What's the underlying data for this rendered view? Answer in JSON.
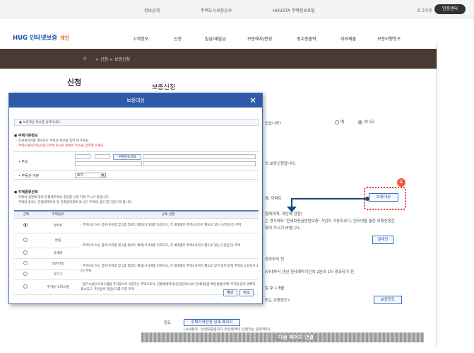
{
  "topbar": {
    "links": [
      "정보공개",
      "주택도시보증공사",
      "HOUSTA 주택정보포털"
    ],
    "login": "로그아웃",
    "cert_button": "인증센터"
  },
  "header": {
    "logo": "HUG 인터넷보증",
    "logo_suffix": "개인",
    "menu": [
      "고객정보",
      "신청",
      "발급/재발급",
      "보증해지/변경",
      "영수증출력",
      "자료제출",
      "보증이행청구"
    ]
  },
  "breadcrumb": {
    "home_icon": "home-icon",
    "items": [
      "신청",
      "보증신청"
    ]
  },
  "page": {
    "side_title": "신청",
    "main_title": "보증신청"
  },
  "background": {
    "question_fragment": "있습니까?",
    "radio_yes": "예",
    "radio_no": "아니오",
    "applied_fragment": "의 보증신청합니다.",
    "fragment_a": "형, 아파트",
    "button_target": "보증대상",
    "fragment_b": "형제자매, 개인에 한함)",
    "fragment_c": "는 경우에도 '전세보증금반환보증' 가입이 가능하오나, 인터넷을 통한 보증신청은",
    "fragment_d": "하여 주시기 바랍니다.",
    "button_lease": "임대인",
    "fragment_e": "경과하지 전",
    "fragment_f": "(이내부터 갱신 전세계약기간의 2분의 1이 경과하기 전",
    "fragment_g": "일 후 1개월",
    "fragment_h": "또는 보증한도?",
    "button_limit": "보증한도",
    "limit_label": "한도",
    "limit_button": "주택가격산정 상세 페이지",
    "limit_note": "(시세정보: 전세보증금보다 주산정액이 인정되는 일부제외)",
    "next_page": "다음 페이지 연결"
  },
  "annotation": {
    "badge": "1"
  },
  "modal": {
    "title": "보증대상",
    "info": "보증대상 정보를 입력하세요.",
    "house_section": "주택기본정보",
    "house_note1": "· 전세계약서를 계약하신 주택의 정보를 입력 해 주세요.",
    "house_note2": "· 주택소재지/부동산등기부에 표시된 정확한 주소를 입력해 주세요.",
    "address_label": "주소",
    "postal_button": "우편번호검색",
    "property_label": "부동산 구분",
    "property_value": "토지",
    "type_section": "주택종류선택",
    "type_note1": "· 아래의 설명에 따라 전월세주택의 종류를 선택 하여 주시기 바랍니다.",
    "type_note2": "· 주택의 종류는 전월세계약서 및 건축물대장에 표시된 '주택의 용도'를 기준으로 합니다.",
    "table_headers": [
      "선택",
      "주택종류",
      "상세 설명"
    ],
    "rows": [
      {
        "type": "아파트",
        "desc": "· 주택으로 쓰는 층수(지하층 및 1층 필로티 제외)가 5개층 이상이고, 각 세대별로 주택소유자가 별도로 있는 (구분등기) 주택",
        "selected": true
      },
      {
        "type": "연립",
        "desc": "· 주택으로 쓰는 층수(지하층 및 1층 필로티 제외)가 4개층 이하이고, 각 세대별로 주택소유자가 별도로 있는(구분등기) 주택",
        "selected": false
      },
      {
        "type": "다세대",
        "desc": "",
        "selected": false
      },
      {
        "type": "일반단독",
        "desc": "· 주택으로 쓰는 층수(지하층 및 1층 필로티 제외)가 3개층 이하이고, 각 세대별로 주택소유자가 별도로 있지 않은(전체 주택의 소유자가 1인) 주택",
        "selected": false
      },
      {
        "type": "다가구",
        "desc": "",
        "selected": false
      },
      {
        "type": "주거용 오피스텔",
        "desc": "· 업무시설인 오피스텔을 주거용으로 사용하는 주택으로서, 전월세계약서(공인중개사)의 '전세대상물 확인설명서'에 '주거용'임이 명확히 표시되고, 주민등록 전입신고를 마친 주택",
        "selected": false
      }
    ],
    "confirm_button": "확인",
    "cancel_button": "취소"
  }
}
